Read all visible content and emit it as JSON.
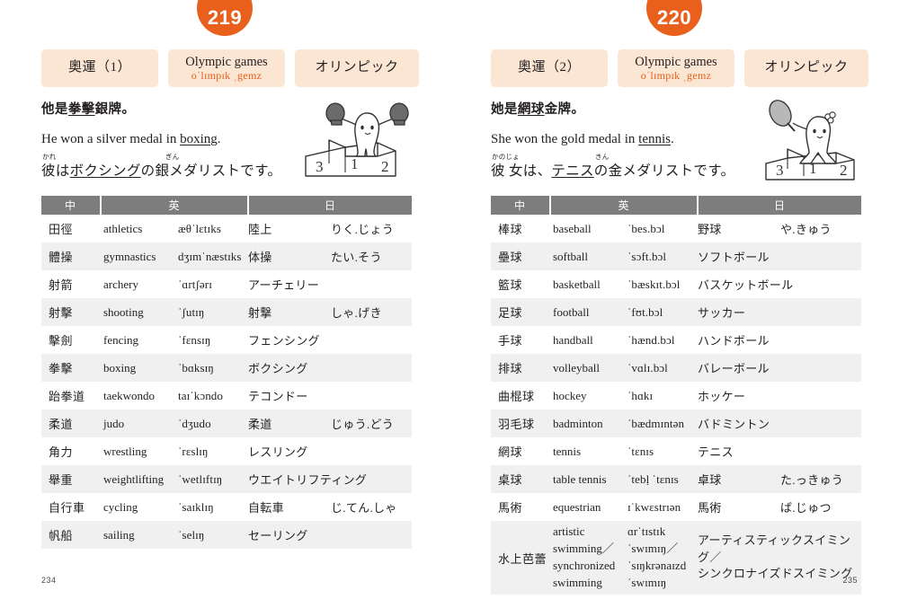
{
  "pages": [
    {
      "badge": "219",
      "tags": {
        "zh": "奧運（1）",
        "en": "Olympic games",
        "ipa": "oˈlɪmpɪk ˌgemz",
        "jp": "オリンピック"
      },
      "sentences": {
        "zh_pre": "他是",
        "zh_underline": "拳擊",
        "zh_post": "銀牌。",
        "en_pre": "He won a silver medal in ",
        "en_underline": "boxing",
        "en_post": ".",
        "jp_furi_1": "かれ",
        "jp_furi_2": "ぎん",
        "jp_a": "彼",
        "jp_b": "は",
        "jp_underline": "ボクシング",
        "jp_c": "の",
        "jp_d": "銀",
        "jp_e": "メダリストです。"
      },
      "mascot": "boxing-mascot-on-podium",
      "table": {
        "headers": [
          "中",
          "英",
          "日"
        ],
        "rows": [
          {
            "zh": "田徑",
            "en": "athletics",
            "ipa": "æθˈlɛtɪks",
            "jp": "陸上",
            "kana": "りく.じょう"
          },
          {
            "zh": "體操",
            "en": "gymnastics",
            "ipa": "dʒɪmˈnæstɪks",
            "jp": "体操",
            "kana": "たい.そう"
          },
          {
            "zh": "射箭",
            "en": "archery",
            "ipa": "ˈɑrtʃərɪ",
            "jp": "アーチェリー",
            "kana": ""
          },
          {
            "zh": "射擊",
            "en": "shooting",
            "ipa": "ˈʃutɪŋ",
            "jp": "射撃",
            "kana": "しゃ.げき"
          },
          {
            "zh": "擊劍",
            "en": "fencing",
            "ipa": "ˈfɛnsɪŋ",
            "jp": "フェンシング",
            "kana": ""
          },
          {
            "zh": "拳擊",
            "en": "boxing",
            "ipa": "ˈbɑksɪŋ",
            "jp": "ボクシング",
            "kana": ""
          },
          {
            "zh": "跆拳道",
            "en": "taekwondo",
            "ipa": "taɪˈkɔndo",
            "jp": "テコンドー",
            "kana": ""
          },
          {
            "zh": "柔道",
            "en": "judo",
            "ipa": "ˈdʒudo",
            "jp": "柔道",
            "kana": "じゅう.どう"
          },
          {
            "zh": "角力",
            "en": "wrestling",
            "ipa": "ˈrɛslɪŋ",
            "jp": "レスリング",
            "kana": ""
          },
          {
            "zh": "舉重",
            "en": "weightlifting",
            "ipa": "ˈwetlɪftɪŋ",
            "jp": "ウエイトリフティング",
            "kana": ""
          },
          {
            "zh": "自行車",
            "en": "cycling",
            "ipa": "ˈsaɪklɪŋ",
            "jp": "自転車",
            "kana": "じ.てん.しゃ"
          },
          {
            "zh": "帆船",
            "en": "sailing",
            "ipa": "ˈselɪŋ",
            "jp": "セーリング",
            "kana": ""
          }
        ]
      },
      "folio": "234"
    },
    {
      "badge": "220",
      "tags": {
        "zh": "奧運（2）",
        "en": "Olympic games",
        "ipa": "oˈlɪmpɪk ˌgemz",
        "jp": "オリンピック"
      },
      "sentences": {
        "zh_pre": "她是",
        "zh_underline": "網球",
        "zh_post": "金牌。",
        "en_pre": "She won the gold medal in ",
        "en_underline": "tennis",
        "en_post": ".",
        "jp_furi_1": "かのじょ",
        "jp_furi_2": "きん",
        "jp_a": "彼 女",
        "jp_b": "は、",
        "jp_underline": "テニス",
        "jp_c": "の",
        "jp_d": "金",
        "jp_e": "メダリストです。"
      },
      "mascot": "tennis-mascot-on-podium",
      "table": {
        "headers": [
          "中",
          "英",
          "日"
        ],
        "rows": [
          {
            "zh": "棒球",
            "en": "baseball",
            "ipa": "ˈbes.bɔl",
            "jp": "野球",
            "kana": "や.きゅう"
          },
          {
            "zh": "壘球",
            "en": "softball",
            "ipa": "ˈsɔft.bɔl",
            "jp": "ソフトボール",
            "kana": ""
          },
          {
            "zh": "籃球",
            "en": "basketball",
            "ipa": "ˈbæskɪt.bɔl",
            "jp": "バスケットボール",
            "kana": ""
          },
          {
            "zh": "足球",
            "en": "football",
            "ipa": "ˈfʊt.bɔl",
            "jp": "サッカー",
            "kana": ""
          },
          {
            "zh": "手球",
            "en": "handball",
            "ipa": "ˈhænd.bɔl",
            "jp": "ハンドボール",
            "kana": ""
          },
          {
            "zh": "排球",
            "en": "volleyball",
            "ipa": "ˈvɑlɪ.bɔl",
            "jp": "バレーボール",
            "kana": ""
          },
          {
            "zh": "曲棍球",
            "en": "hockey",
            "ipa": "ˈhɑkɪ",
            "jp": "ホッケー",
            "kana": ""
          },
          {
            "zh": "羽毛球",
            "en": "badminton",
            "ipa": "ˈbædmɪntən",
            "jp": "バドミントン",
            "kana": ""
          },
          {
            "zh": "網球",
            "en": "tennis",
            "ipa": "ˈtɛnɪs",
            "jp": "テニス",
            "kana": ""
          },
          {
            "zh": "桌球",
            "en": "table tennis",
            "ipa": "ˈtebḷ ˈtɛnɪs",
            "jp": "卓球",
            "kana": "た.っきゅう"
          },
          {
            "zh": "馬術",
            "en": "equestrian",
            "ipa": "ɪˈkwɛstrɪən",
            "jp": "馬術",
            "kana": "ば.じゅつ"
          }
        ],
        "last_row": {
          "zh": "水上芭蕾",
          "en": "artistic\nswimming／\nsynchronized\nswimming",
          "ipa": "ɑrˈtɪstɪk\nˈswɪmɪŋ／\nˈsɪŋkrənaɪzd\nˈswɪmɪŋ",
          "jp": "アーティスティックスイミング／\nシンクロナイズドスイミング"
        }
      },
      "folio": "235"
    }
  ],
  "colors": {
    "accent": "#e8601c",
    "tag_bg": "#fbe5d3",
    "header_bg": "#7d7d7d",
    "row_alt": "#f0f0f0"
  }
}
